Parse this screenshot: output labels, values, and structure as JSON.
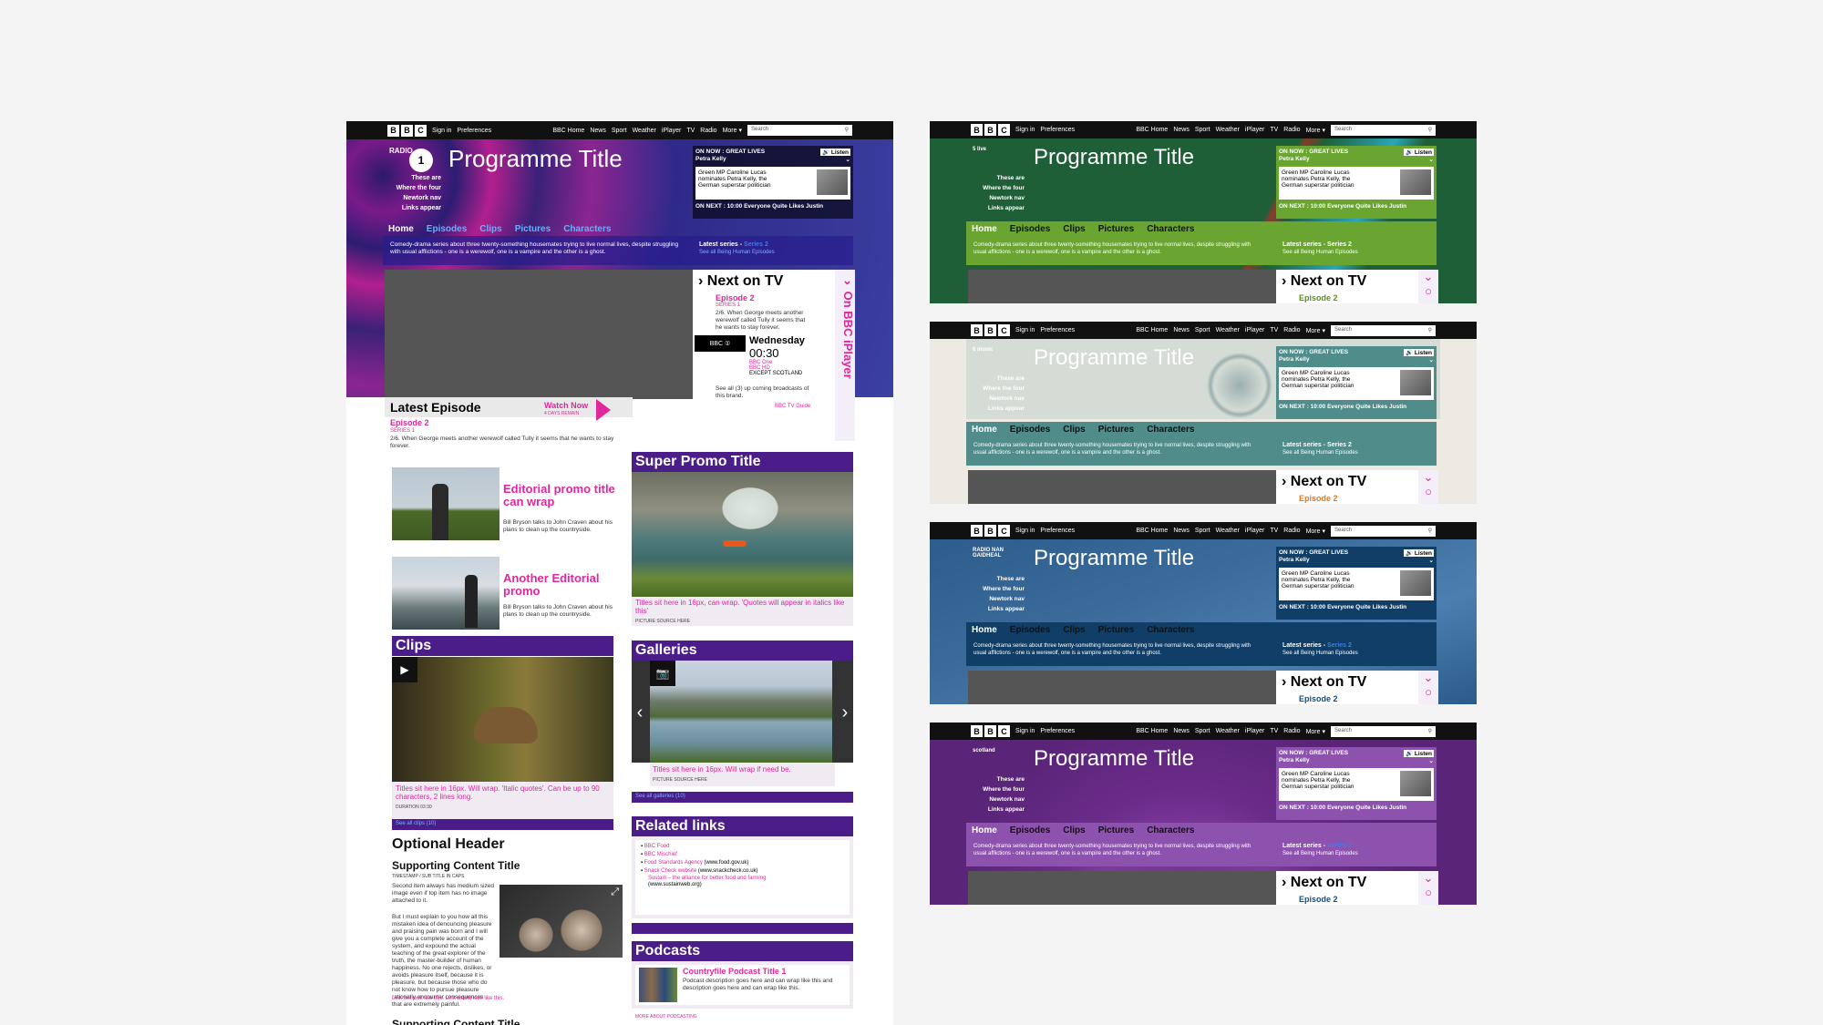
{
  "bar": {
    "logo": [
      "B",
      "B",
      "C"
    ],
    "signin": "Sign in",
    "preferences": "Preferences",
    "links": [
      "BBC Home",
      "News",
      "Sport",
      "Weather",
      "iPlayer",
      "TV",
      "Radio",
      "More ▾"
    ],
    "search_placeholder": "Search"
  },
  "header": {
    "programme_title": "Programme Title",
    "radio": "RADIO",
    "net_nav": [
      "These are",
      "Where the four",
      "Newtork nav",
      "Links appear"
    ],
    "on_now": "ON NOW : GREAT LIVES",
    "listen": "Listen",
    "presenter": "Petra Kelly",
    "on_now_text": "Green MP Caroline Lucas nominates Petra Kelly, the German superstar politician",
    "on_next": "ON NEXT : 10:00 Everyone Quite Likes Justin"
  },
  "nav": {
    "items": [
      "Home",
      "Episodes",
      "Clips",
      "Pictures",
      "Characters"
    ]
  },
  "description": "Comedy-drama series about three twenty-something housemates trying to live normal lives, despite struggling with usual afflictions - one is a werewolf, one is a vampire and the other is a ghost.",
  "latest_series": {
    "label": "Latest series - ",
    "series": "Series 2",
    "see_all": "See all Being Human Episodes"
  },
  "next_on_tv": {
    "title": "Next on TV",
    "episode": "Episode 2",
    "series": "SERIES 1",
    "text": "2/6. When George meets another werewolf called Tully it seems that he wants to stay forever.",
    "day": "Wednesday",
    "time": "00:30",
    "channels": [
      "BBC One",
      "BBC HD"
    ],
    "except": "EXCEPT SCOTLAND",
    "see_all": "See all (3) up coming broadcasts of this brand.",
    "guide": "BBC TV Guide",
    "iplayer": "On BBC iPlayer"
  },
  "latest_episode": {
    "title": "Latest Episode",
    "episode": "Episode 2",
    "series": "SERIES 1",
    "text": "2/6. When George meets another werewolf called Tully it seems that he wants to stay forever.",
    "watch": "Watch Now",
    "remain": "4 DAYS REMAIN"
  },
  "promos": [
    {
      "title": "Editorial promo title can wrap",
      "text": "Bill Bryson talks to John Craven about his plans to clean up the countryside."
    },
    {
      "title": "Another Editorial promo",
      "text": "Bill Bryson talks to John Craven about his plans to clean up the countryside."
    }
  ],
  "clips": {
    "title": "Clips",
    "caption": "Titles sit here in 16px. Will wrap. 'Italic quotes'. Can be up to 90 characters, 2 lines long.",
    "duration": "DURATION 03:30",
    "see_all": "See all clips (10)"
  },
  "optional": {
    "header": "Optional Header",
    "title": "Supporting Content Title",
    "timestamp": "TIMESTAMP / SUB TITLE IN CAPS",
    "p1": "Second item always has medium sized image even if top item has no image attached to it.",
    "p2": "But I must explain to you how all this mistaken idea of denouncing pleasure and praising pain was born and I will give you a complete account of the system, and expound the actual teaching of the great explorer of the truth, the master-builder of human happiness. No one rejects, dislikes, or avoids pleasure itself, because it is pleasure, but because those who do not know how to pursue pleasure rationally encounter consequences that are extremely painful.",
    "link": "Link will look like this. Link would look like this.",
    "next_title": "Supporting Content Title"
  },
  "super_promo": {
    "title": "Super Promo Title",
    "caption": "Titles sit here in 16px, can wrap. 'Quotes will appear in italics like this'",
    "source": "PICTURE SOURCE HERE"
  },
  "galleries": {
    "title": "Galleries",
    "caption": "Titles sit here in 16px. Will wrap if need be.",
    "source": "PICTURE SOURCE HERE",
    "see_all": "See all galleries (10)"
  },
  "related": {
    "title": "Related links",
    "links": [
      {
        "a": "BBC Food",
        "b": ""
      },
      {
        "a": "BBC Mischief",
        "b": ""
      },
      {
        "a": "Food Standards Agency",
        "b": " (www.food.gov.uk)"
      },
      {
        "a": "Snack Check website",
        "b": " (www.snackcheck.co.uk)"
      }
    ],
    "sustain": "Sustain – the alliance for better food and farming",
    "sustain_url": "(www.sustainweb.org)"
  },
  "podcasts": {
    "title": "Podcasts",
    "item_title": "Countryfile Podcast Title 1",
    "item_text": "Podcast description goes here and can wrap like this and description goes here and can wrap like this.",
    "more": "MORE ABOUT PODCASTING"
  },
  "variants": [
    {
      "station": "5 live",
      "base": "#1f5f37",
      "nav": "#6aa532",
      "accent": "#6aa532",
      "ep": "#5a8f1e",
      "tv": "#5a8f1e"
    },
    {
      "station": "6 music",
      "base": "#e8e6de",
      "nav": "#4f8c8a",
      "accent": "#4f8c8a",
      "ep": "#e8771b",
      "tv": "#e8771b"
    },
    {
      "station": "RADIO NAN GAIDHEAL",
      "base": "#3b6b9a",
      "nav": "#103e66",
      "accent": "#103e66",
      "ep": "#0f4d8a",
      "tv": "#0f4d8a"
    },
    {
      "station": "scotland",
      "base": "#6b2c8a",
      "nav": "#8d52ad",
      "accent": "#8d52ad",
      "ep": "#0f4d8a",
      "tv": "#0f4d8a"
    }
  ],
  "colors": {
    "purple": "#4b1d89",
    "pink": "#e0279b",
    "blue": "#3d7cf0"
  }
}
